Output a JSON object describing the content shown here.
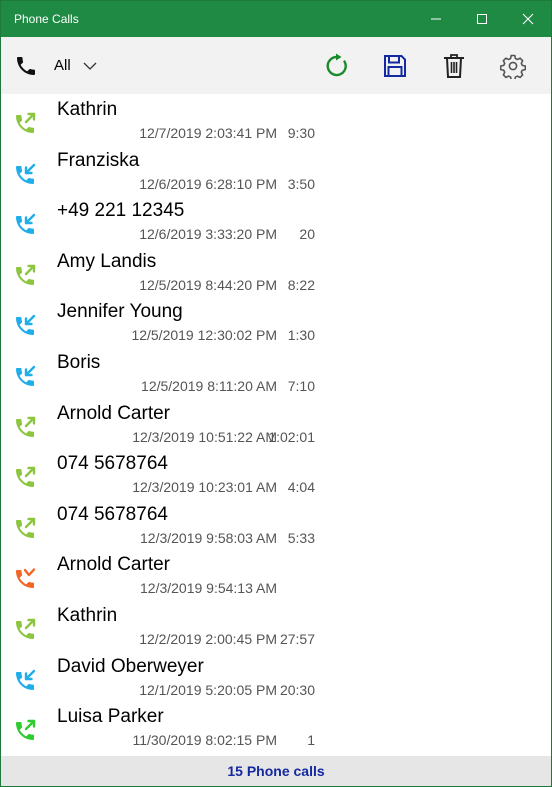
{
  "window": {
    "title": "Phone Calls"
  },
  "toolbar": {
    "filter_value": "All"
  },
  "calls": [
    {
      "name": "Kathrin",
      "date": "12/7/2019 2:03:41 PM",
      "duration": "9:30",
      "type": "outgoing"
    },
    {
      "name": "Franziska",
      "date": "12/6/2019 6:28:10 PM",
      "duration": "3:50",
      "type": "incoming"
    },
    {
      "name": "+49 221 12345",
      "date": "12/6/2019 3:33:20 PM",
      "duration": "20",
      "type": "incoming"
    },
    {
      "name": "Amy Landis",
      "date": "12/5/2019 8:44:20 PM",
      "duration": "8:22",
      "type": "outgoing"
    },
    {
      "name": "Jennifer Young",
      "date": "12/5/2019 12:30:02 PM",
      "duration": "1:30",
      "type": "incoming"
    },
    {
      "name": "Boris",
      "date": "12/5/2019 8:11:20 AM",
      "duration": "7:10",
      "type": "incoming"
    },
    {
      "name": "Arnold Carter",
      "date": "12/3/2019 10:51:22 AM",
      "duration": "1:02:01",
      "type": "outgoing"
    },
    {
      "name": "074 5678764",
      "date": "12/3/2019 10:23:01 AM",
      "duration": "4:04",
      "type": "outgoing"
    },
    {
      "name": "074 5678764",
      "date": "12/3/2019 9:58:03 AM",
      "duration": "5:33",
      "type": "outgoing"
    },
    {
      "name": "Arnold Carter",
      "date": "12/3/2019 9:54:13 AM",
      "duration": "",
      "type": "missed"
    },
    {
      "name": "Kathrin",
      "date": "12/2/2019 2:00:45 PM",
      "duration": "27:57",
      "type": "outgoing"
    },
    {
      "name": "David Oberweyer",
      "date": "12/1/2019 5:20:05 PM",
      "duration": "20:30",
      "type": "incoming"
    },
    {
      "name": "Luisa Parker",
      "date": "11/30/2019 8:02:15 PM",
      "duration": "1",
      "type": "outgoing-bright"
    }
  ],
  "status": {
    "text": "15 Phone calls"
  },
  "colors": {
    "titlebar": "#1f8a44",
    "outgoing": "#8cc63e",
    "outgoing-bright": "#2ecc2e",
    "incoming": "#1faee9",
    "missed": "#f26522",
    "refresh": "#1a8a2a",
    "save": "#1428a0",
    "status_text": "#1428a0"
  },
  "icons": {
    "minimize": "minimize-icon",
    "maximize": "maximize-icon",
    "close": "close-icon",
    "filter": "phone-icon",
    "dropdown": "chevron-down-icon",
    "refresh": "refresh-icon",
    "save": "save-icon",
    "delete": "trash-icon",
    "settings": "gear-icon"
  }
}
